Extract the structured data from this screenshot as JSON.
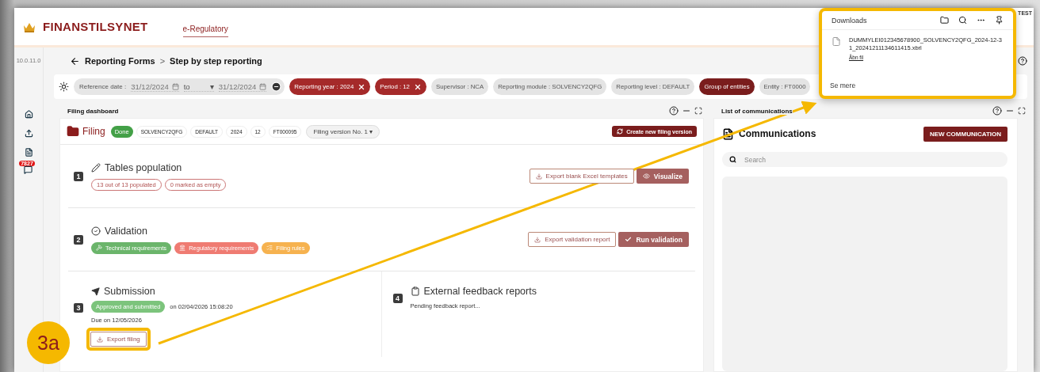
{
  "header": {
    "brand": "FINANSTILSYNET",
    "nav": [
      {
        "label": "e-Regulatory",
        "selected": true
      }
    ],
    "env": "TEST"
  },
  "sidebar": {
    "version": "10.0.11.0",
    "items": [
      {
        "kind": "home"
      },
      {
        "kind": "upload"
      },
      {
        "kind": "list"
      },
      {
        "kind": "chat",
        "badge": "7827"
      }
    ]
  },
  "breadcrumb": {
    "parent": "Reporting Forms",
    "separator": ">",
    "current": "Step by step reporting"
  },
  "filters": {
    "date": {
      "label": "Reference date :",
      "from": "31/12/2024",
      "to_label": "to",
      "caret": "▾",
      "to": "31/12/2024"
    },
    "chips": [
      {
        "label": "Reporting year : 2024",
        "kind": "removable"
      },
      {
        "label": "Period : 12",
        "kind": "removable"
      },
      {
        "label": "Supervisor : NCA",
        "kind": "info"
      },
      {
        "label": "Reporting module : SOLVENCY2QFG",
        "kind": "info"
      },
      {
        "label": "Reporting level : DEFAULT",
        "kind": "info"
      },
      {
        "label": "Group of entities",
        "kind": "toggle"
      },
      {
        "label": "Entity : FT0000",
        "kind": "info"
      }
    ]
  },
  "dashboard": {
    "title": "Filing dashboard",
    "filing": {
      "title": "Filing",
      "status": "Done",
      "tags": [
        "SOLVENCY2QFG",
        "DEFAULT",
        "2024",
        "12",
        "FT000095"
      ],
      "version": "Filing version No. 1",
      "version_caret": "▾",
      "new_version": "Create new filing version"
    },
    "steps": [
      {
        "number": "1",
        "kind": "tables",
        "title": "Tables population",
        "tags": [
          {
            "label": "13 out of 13 populated",
            "kind": "outline"
          },
          {
            "label": "0 marked as empty",
            "kind": "outline"
          }
        ],
        "buttons": [
          {
            "label": "Export blank Excel templates",
            "kind": "export"
          },
          {
            "label": "Visualize",
            "kind": "visualize"
          }
        ]
      },
      {
        "number": "2",
        "kind": "validation",
        "title": "Validation",
        "tags": [
          {
            "label": "Technical requirements",
            "kind": "technical",
            "color": "#6bb56b"
          },
          {
            "label": "Regulatory requirements",
            "kind": "regulatory",
            "color": "#ef7b72"
          },
          {
            "label": "Filing rules",
            "kind": "rules",
            "color": "#f6b24f"
          }
        ],
        "buttons": [
          {
            "label": "Export validation report",
            "kind": "export"
          },
          {
            "label": "Run validation",
            "kind": "run"
          }
        ]
      }
    ],
    "submission": {
      "number": "3",
      "title": "Submission",
      "status": "Approved and submitted",
      "date": "on 02/04/2026 15:08:20",
      "due": "Due on 12/05/2026",
      "button": "Export filing"
    },
    "feedback": {
      "number": "4",
      "title": "External feedback reports",
      "text": "Pending feedback report..."
    }
  },
  "communications": {
    "panel_title": "List of communications",
    "title": "Communications",
    "button": "NEW COMMUNICATION",
    "search": {
      "placeholder": "Search"
    }
  },
  "downloads": {
    "title": "Downloads",
    "file": {
      "name": "DUMMYLEI012345678900_SOLVENCY2QFG_2024-12-31_20241211134611415.xbrl",
      "action": "Åbn fil"
    },
    "more": "Se mere"
  },
  "annotation": {
    "label": "3a"
  }
}
